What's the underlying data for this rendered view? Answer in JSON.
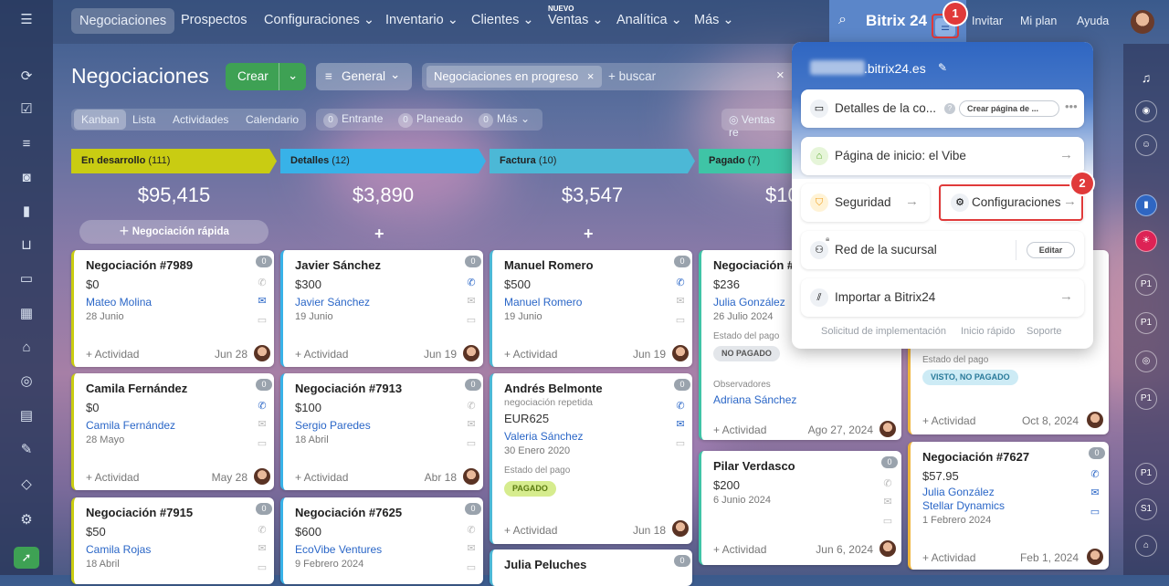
{
  "topnav": {
    "items": [
      "Negociaciones",
      "Prospectos",
      "Configuraciones",
      "Inventario",
      "Clientes",
      "Ventas",
      "Analítica",
      "Más"
    ],
    "new_badge": "NUEVO",
    "brand": "Bitrix 24",
    "links": [
      "Invitar",
      "Mi plan",
      "Ayuda"
    ]
  },
  "page": {
    "title": "Negociaciones",
    "create_button": "Crear",
    "general_button": "General",
    "filter_chip": "Negociaciones en progreso",
    "search_placeholder": "+ buscar",
    "subtabs": [
      "Kanban",
      "Lista",
      "Actividades",
      "Calendario"
    ],
    "counters": [
      {
        "count": "0",
        "label": "Entrante"
      },
      {
        "count": "0",
        "label": "Planeado"
      },
      {
        "count": "0",
        "label": "Más"
      }
    ],
    "right_filter": "Ventas re"
  },
  "columns": [
    {
      "name": "En desarrollo",
      "count": "(111)",
      "sum": "$95,415",
      "color": "#c9cc12",
      "quick_add": "Negociación rápida"
    },
    {
      "name": "Detalles",
      "count": "(12)",
      "sum": "$3,890",
      "color": "#38b2e8"
    },
    {
      "name": "Factura",
      "count": "(10)",
      "sum": "$3,547",
      "color": "#4cb8d6"
    },
    {
      "name": "Pagado",
      "count": "(7)",
      "sum": "$10",
      "color": "#3fc4a6"
    }
  ],
  "cards": {
    "c1": {
      "title": "Negociación #7989",
      "amount": "$0",
      "contact": "Mateo Molina",
      "date": "28 Junio",
      "activity": "+ Actividad",
      "due": "Jun 28",
      "badge": "0"
    },
    "c2": {
      "title": "Camila Fernández",
      "amount": "$0",
      "contact": "Camila Fernández",
      "date": "28 Mayo",
      "activity": "+ Actividad",
      "due": "May 28",
      "badge": "0"
    },
    "c3": {
      "title": "Negociación #7915",
      "amount": "$50",
      "contact": "Camila Rojas",
      "date": "18 Abril",
      "badge": "0"
    },
    "c4": {
      "title": "Javier Sánchez",
      "amount": "$300",
      "contact": "Javier Sánchez",
      "date": "19 Junio",
      "activity": "+ Actividad",
      "due": "Jun 19",
      "badge": "0"
    },
    "c5": {
      "title": "Negociación #7913",
      "amount": "$100",
      "contact": "Sergio Paredes",
      "date": "18 Abril",
      "activity": "+ Actividad",
      "due": "Abr 18",
      "badge": "0"
    },
    "c6": {
      "title": "Negociación #7625",
      "amount": "$600",
      "contact": "EcoVibe Ventures",
      "date": "9 Febrero 2024",
      "badge": "0"
    },
    "c7": {
      "title": "Manuel Romero",
      "amount": "$500",
      "contact": "Manuel Romero",
      "date": "19 Junio",
      "activity": "+ Actividad",
      "due": "Jun 19",
      "badge": "0"
    },
    "c8": {
      "title": "Andrés Belmonte",
      "subtitle": "negociación repetida",
      "amount": "EUR625",
      "contact": "Valeria Sánchez",
      "date": "30 Enero 2020",
      "section": "Estado del pago",
      "pill": "PAGADO",
      "activity": "+ Actividad",
      "due": "Jun 18",
      "badge": "0"
    },
    "c9": {
      "title": "Julia Peluches",
      "badge": "0"
    },
    "c10": {
      "title": "Negociación #7",
      "amount": "$236",
      "contact": "Julia González",
      "date": "26 Julio 2024",
      "section": "Estado del pago",
      "pill": "NO PAGADO",
      "observers": "Observadores",
      "observer": "Adriana Sánchez",
      "activity": "+ Actividad",
      "due": "Ago 27, 2024",
      "badge": "0"
    },
    "c11": {
      "title": "Pilar Verdasco",
      "amount": "$200",
      "date": "6 Junio 2024",
      "activity": "+ Actividad",
      "due": "Jun 6, 2024",
      "badge": "0"
    },
    "c12": {
      "section": "Estado del pago",
      "pill": "VISTO, NO PAGADO",
      "activity": "+ Actividad",
      "due": "Oct 8, 2024"
    },
    "c13": {
      "title": "Negociación #7627",
      "amount": "$57.95",
      "contact": "Julia González",
      "company": "Stellar Dynamics",
      "date": "1 Febrero 2024",
      "activity": "+ Actividad",
      "due": "Feb 1, 2024",
      "badge": "0"
    }
  },
  "popup": {
    "domain": ".bitrix24.es",
    "rows": {
      "details": "Detalles de la co...",
      "create_page": "Crear página de ...",
      "home": "Página de inicio: el Vibe",
      "security": "Seguridad",
      "settings": "Configuraciones",
      "branch": "Red de la sucursal",
      "edit": "Editar",
      "import": "Importar a Bitrix24"
    },
    "footer": [
      "Solicitud de implementación",
      "Inicio rápido",
      "Soporte"
    ]
  },
  "markers": [
    "1",
    "2"
  ],
  "colors": {
    "accent_red": "#e03a3a",
    "create_green": "#3ea154",
    "link_blue": "#2a66c7"
  }
}
